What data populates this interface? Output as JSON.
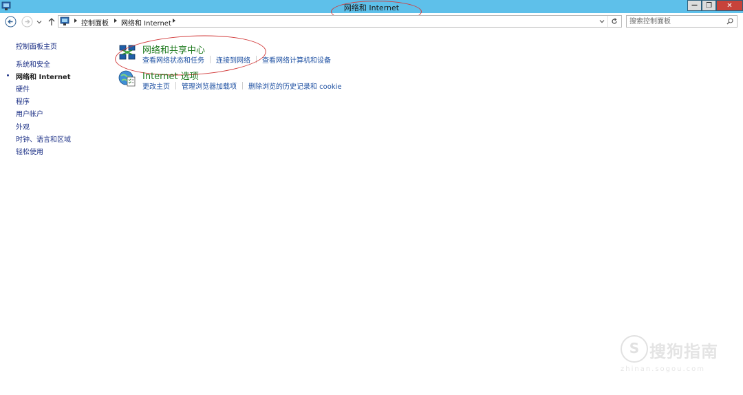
{
  "window": {
    "title": "网络和 Internet",
    "minimize_glyph": "—",
    "maximize_glyph": "❐",
    "close_glyph": "✕"
  },
  "nav": {
    "back_icon": "arrow-left-icon",
    "forward_icon": "arrow-right-icon",
    "recent_icon": "chevron-down-icon",
    "up_icon": "arrow-up-icon",
    "address": {
      "breadcrumbs": [
        "控制面板",
        "网络和 Internet"
      ],
      "dropdown_icon": "chevron-down-icon",
      "refresh_icon": "refresh-icon"
    },
    "search": {
      "placeholder": "搜索控制面板",
      "icon": "search-icon"
    }
  },
  "sidebar": {
    "items": [
      {
        "label": "控制面板主页",
        "current": false
      },
      {
        "label": "系统和安全",
        "current": false
      },
      {
        "label": "网络和 Internet",
        "current": true
      },
      {
        "label": "硬件",
        "current": false
      },
      {
        "label": "程序",
        "current": false
      },
      {
        "label": "用户帐户",
        "current": false
      },
      {
        "label": "外观",
        "current": false
      },
      {
        "label": "时钟、语言和区域",
        "current": false
      },
      {
        "label": "轻松使用",
        "current": false
      }
    ]
  },
  "main": {
    "categories": [
      {
        "title": "网络和共享中心",
        "icon": "network-sharing-center-icon",
        "links": [
          "查看网络状态和任务",
          "连接到网络",
          "查看网络计算机和设备"
        ]
      },
      {
        "title": "Internet 选项",
        "icon": "internet-options-icon",
        "links": [
          "更改主页",
          "管理浏览器加载项",
          "删除浏览的历史记录和 cookie"
        ]
      }
    ]
  },
  "watermark": {
    "logo_glyph": "S",
    "text": "搜狗指南",
    "domain": "zhinan.sogou.com"
  },
  "colors": {
    "titlebar": "#5ec0ea",
    "link": "#1e50a2",
    "category_title": "#1e7a1e",
    "sidebar_link": "#1e3287",
    "annotation": "#d23b3b"
  }
}
